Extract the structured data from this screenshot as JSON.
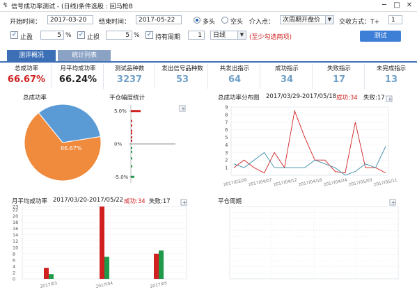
{
  "window": {
    "icon_glyph": "↯",
    "title": "信号成功率测试 - (日线)条件选股 : 回马枪B",
    "min_glyph": "─",
    "max_glyph": "□",
    "close_glyph": "✕"
  },
  "params": {
    "start_label": "开始时间：",
    "start_value": "2017-03-20",
    "end_label": "结束时间：",
    "end_value": "2017-05-22",
    "long_label": "多头",
    "short_label": "空头",
    "long_selected": true,
    "entry_label": "介入点：",
    "entry_value": "次周期开盘价",
    "trade_label": "交收方式：T+",
    "trade_value": "1",
    "take_profit_label": "止盈",
    "take_profit_value": "5",
    "stop_loss_label": "止损",
    "stop_loss_value": "5",
    "percent": "%",
    "hold_label": "持有周期",
    "hold_value": "1",
    "period_value": "日线",
    "hint": "(至少勾选两项)",
    "test_button": "测试",
    "check_glyph": "✓",
    "arrow_glyph": "▼"
  },
  "tabs": [
    {
      "label": "测评概况",
      "active": true
    },
    {
      "label": "统计列表",
      "active": false
    }
  ],
  "stats": [
    {
      "label": "总成功率",
      "value": "66.67%",
      "color": "#d02020"
    },
    {
      "label": "月平均成功率",
      "value": "66.24%",
      "color": "#222222"
    },
    {
      "label": "测试品种数",
      "value": "3237",
      "color": "#6fa0c8"
    },
    {
      "label": "发出信号品种数",
      "value": "53",
      "color": "#6fa0c8"
    },
    {
      "label": "共发出指示",
      "value": "64",
      "color": "#6fa0c8"
    },
    {
      "label": "成功指示",
      "value": "34",
      "color": "#6fa0c8"
    },
    {
      "label": "失败指示",
      "value": "17",
      "color": "#6fa0c8"
    },
    {
      "label": "未完成指示",
      "value": "13",
      "color": "#6fa0c8"
    }
  ],
  "panels": {
    "pie_title": "总成功率",
    "hist_title": "平仓幅度统计",
    "dist_title": "总成功率分布图",
    "dist_range": "2017/03/29-2017/05/18",
    "monthly_title": "月平均成功率",
    "monthly_range": "2017/03/20-2017/05/22",
    "success_label": "成功:34",
    "fail_label": "失败:17",
    "hold_title": "平仓周期",
    "expand_glyph": "+"
  },
  "colors": {
    "success": "#f08a3c",
    "fail": "#5b9bd5",
    "red": "#d02020",
    "green": "#1f9a4a",
    "teal": "#3a8aa6"
  },
  "chart_data": [
    {
      "type": "pie",
      "slices": [
        {
          "name": "成功",
          "value": 66.67,
          "label": "66.67%"
        },
        {
          "name": "失败",
          "value": 33.33
        }
      ]
    },
    {
      "type": "bar",
      "orientation": "horizontal",
      "ticks": [
        "5.0%",
        "0%",
        "-5.0%"
      ],
      "ylim": [
        -5.5,
        5.5
      ],
      "red_values": [
        5.0,
        3.5,
        2.8,
        2.0,
        1.6,
        1.0,
        0.5
      ],
      "green_values": [
        -0.6,
        -1.2,
        -2.2,
        -3.4,
        -5.0
      ]
    },
    {
      "type": "line",
      "ylim": [
        0,
        9
      ],
      "yticks": [
        "9",
        "8",
        "7",
        "6",
        "5",
        "4",
        "3",
        "2",
        "1"
      ],
      "xticks": [
        "2017/03/29",
        "2017/04/07",
        "2017/04/12",
        "2017/04/18",
        "2017/04/24",
        "2017/05/03",
        "2017/05/11"
      ],
      "series": [
        {
          "name": "成功",
          "color": "#d02020",
          "values": [
            1,
            2,
            1,
            0.3,
            3,
            1,
            8.5,
            5,
            2,
            2,
            0.5,
            0.3,
            7,
            1,
            1,
            0.3
          ]
        },
        {
          "name": "失败",
          "color": "#3a8aa6",
          "values": [
            1.5,
            1,
            2,
            3,
            1,
            1,
            1,
            1,
            2,
            1.5,
            1,
            0,
            0.5,
            1.5,
            1,
            3.8
          ]
        }
      ]
    },
    {
      "type": "bar",
      "categories": [
        "2017/03",
        "2017/04",
        "2017/05"
      ],
      "ylim": [
        0,
        23
      ],
      "yticks": [
        "23",
        "22",
        "20",
        "18",
        "16",
        "14",
        "12",
        "10",
        "8",
        "6",
        "4",
        "2",
        "0"
      ],
      "series": [
        {
          "name": "成功",
          "color": "#d02020",
          "values": [
            3.5,
            23,
            8
          ]
        },
        {
          "name": "失败",
          "color": "#1f9a4a",
          "values": [
            1.5,
            7,
            9
          ]
        }
      ]
    }
  ]
}
